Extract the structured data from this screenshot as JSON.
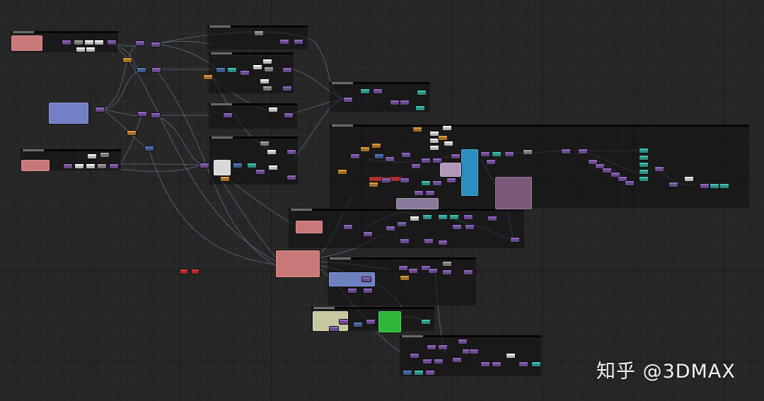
{
  "watermark": {
    "text": "知乎 @3DMAX"
  },
  "colors": {
    "canvas_background": "#262626",
    "node_purple": "#6a4a8c",
    "node_teal": "#2f8f83",
    "node_pink": "#c87878",
    "node_blue_comment": "#7280c6",
    "node_green": "#2fb53a",
    "node_cyan": "#2a8fc0",
    "node_mauve": "#7a5a78",
    "wire": "#6c7c9c"
  },
  "icons": {
    "red-nodes": "red-node-icon"
  }
}
